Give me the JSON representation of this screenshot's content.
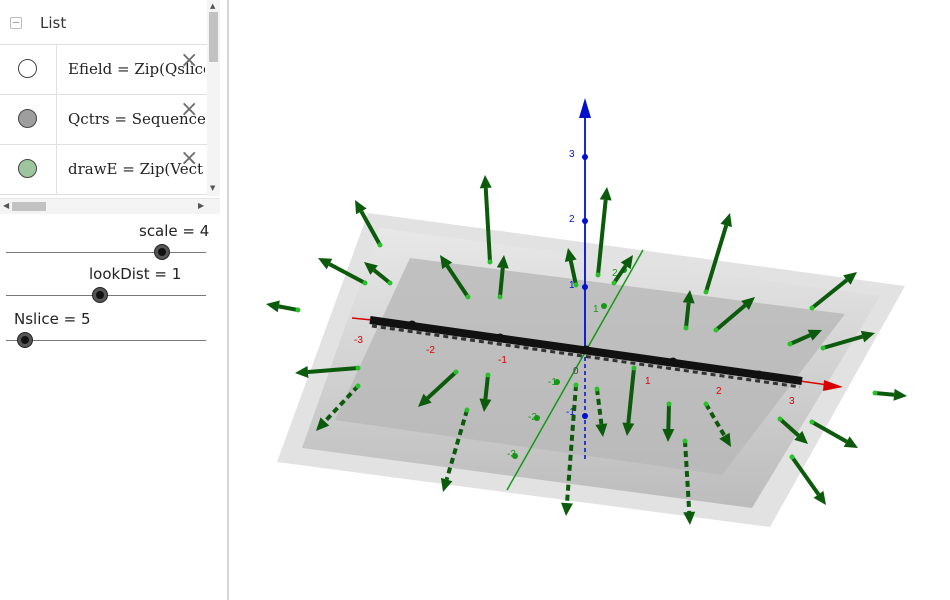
{
  "algebra": {
    "list_title": "List",
    "rows": [
      {
        "definition": "Efield = Zip(Qslice",
        "marble_color": "#ffffff"
      },
      {
        "definition": "Qctrs = Sequence",
        "marble_color": "#9e9e9e"
      },
      {
        "definition": "drawE = Zip(Vect",
        "marble_color": "#9fc59f"
      }
    ],
    "delete_glyph": "×",
    "sliders": [
      {
        "label": "scale = 4",
        "value": 4
      },
      {
        "label": "lookDist = 1",
        "value": 1
      },
      {
        "label": "Nslice = 5",
        "value": 5
      }
    ]
  },
  "graphics3d": {
    "axis_colors": {
      "x": "#d90000",
      "y": "#119911",
      "z": "#0010cc"
    },
    "vector_color": "#0c5a0c",
    "x_ticks": [
      "-3",
      "-2",
      "-1",
      "1",
      "2",
      "3"
    ],
    "y_ticks": [
      "-3",
      "-2",
      "-1",
      "1",
      "2"
    ],
    "z_ticks": [
      "-1",
      "1",
      "2",
      "3"
    ],
    "origin_label": "0"
  }
}
